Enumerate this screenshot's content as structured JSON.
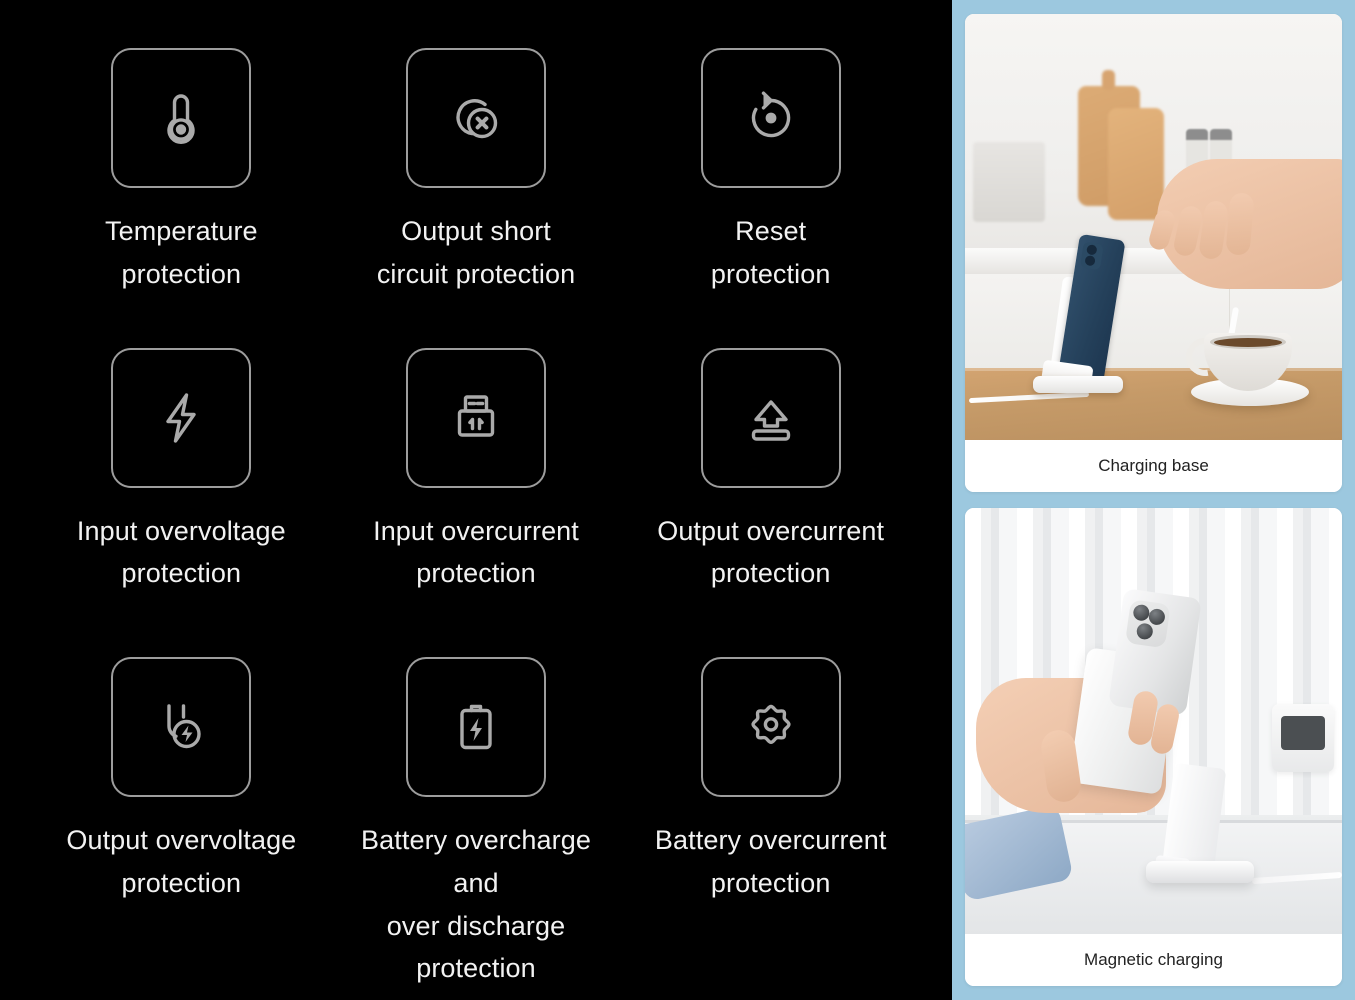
{
  "features": {
    "rows": [
      [
        {
          "icon": "thermometer-icon",
          "label": "Temperature\nprotection"
        },
        {
          "icon": "short-circuit-icon",
          "label": "Output short\ncircuit protection"
        },
        {
          "icon": "reset-icon",
          "label": "Reset\nprotection"
        }
      ],
      [
        {
          "icon": "lightning-bolt-icon",
          "label": "Input overvoltage\nprotection"
        },
        {
          "icon": "usb-connector-icon",
          "label": "Input overcurrent\nprotection"
        },
        {
          "icon": "eject-output-icon",
          "label": "Output overcurrent\nprotection"
        }
      ],
      [
        {
          "icon": "plug-bolt-icon",
          "label": "Output overvoltage\nprotection"
        },
        {
          "icon": "battery-bolt-icon",
          "label": "Battery overcharge\nand\nover discharge\nprotection"
        },
        {
          "icon": "gear-icon",
          "label": "Battery overcurrent\nprotection"
        }
      ]
    ]
  },
  "photos": {
    "cards": [
      {
        "caption": "Charging base",
        "scene": "blue iPhone on white folding charging stand on wooden table in a white kitchen, hand stirring a cup of coffee"
      },
      {
        "caption": "Magnetic charging",
        "scene": "hand holding white phone with magnetic power bank attached beside an empty white charging stand on a desk"
      }
    ]
  },
  "colors": {
    "background": "#000000",
    "panel_blue": "#9cc8df",
    "icon_stroke": "#9d9d9d",
    "label_text": "#f2f2f2",
    "caption_text": "#222222",
    "card_background": "#ffffff"
  }
}
